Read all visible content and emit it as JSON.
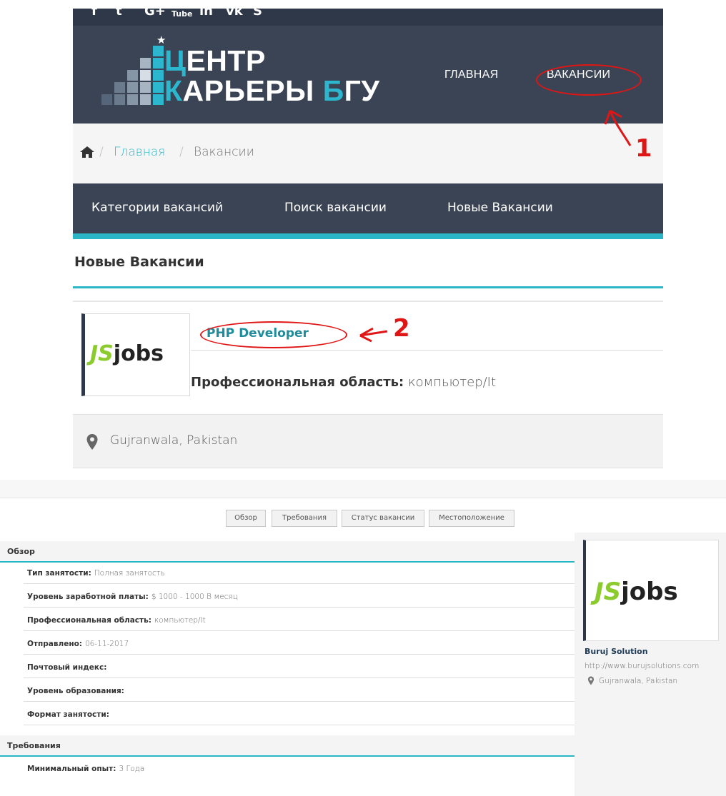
{
  "top": {
    "social_icons": [
      "f",
      "t",
      "G+",
      "Tube",
      "in",
      "vk",
      "S"
    ],
    "logo": {
      "line1_prefix": "Ц",
      "line1_rest": "ЕНТР",
      "line2_prefix": "К",
      "line2_mid": "АРЬЕРЫ ",
      "line2_accent": "Б",
      "line2_rest": "ГУ",
      "star": "★"
    },
    "nav": {
      "home": "ГЛАВНАЯ",
      "vacancies": "ВАКАНСИИ"
    },
    "annotation1": "1",
    "breadcrumb": {
      "sep1": "/",
      "home_link": "Главная",
      "sep2": "/",
      "current": "Вакансии"
    },
    "tabs": [
      "Категории вакансий",
      "Поиск вакансии",
      "Новые Вакансии"
    ],
    "section_title": "Новые Вакансии",
    "job": {
      "logo_js": "JS",
      "logo_jobs": "jobs",
      "title": "PHP Developer",
      "area_label": "Профессиональная область:",
      "area_value": "компьютер/It",
      "location": "Gujranwala, Pakistan"
    },
    "annotation2": "2"
  },
  "bottom": {
    "tab_buttons": [
      "Обзор",
      "Требования",
      "Статус вакансии",
      "Местоположение"
    ],
    "overview_title": "Обзор",
    "overview_rows": [
      {
        "label": "Тип занятости:",
        "value": "Полная занятость"
      },
      {
        "label": "Уровень заработной платы:",
        "value": "$ 1000 - 1000 В месяц"
      },
      {
        "label": "Профессиональная область:",
        "value": "компьютер/It"
      },
      {
        "label": "Отправлено:",
        "value": "06-11-2017"
      },
      {
        "label": "Почтовый индекс:",
        "value": ""
      },
      {
        "label": "Уровень образования:",
        "value": ""
      },
      {
        "label": "Формат занятости:",
        "value": ""
      }
    ],
    "requirements_title": "Требования",
    "requirements_rows": [
      {
        "label": "Минимальный опыт:",
        "value": "3 Года"
      }
    ],
    "company": {
      "logo_js": "JS",
      "logo_jobs": "jobs",
      "name": "Buruj Solution",
      "url": "http://www.burujsolutions.com",
      "location": "Gujranwala, Pakistan"
    }
  },
  "colors": {
    "header_bg": "#3b4454",
    "accent": "#2bb6c8",
    "link": "#1f8c9c",
    "annotation": "#e01515",
    "logo_green": "#8ccb2e"
  }
}
